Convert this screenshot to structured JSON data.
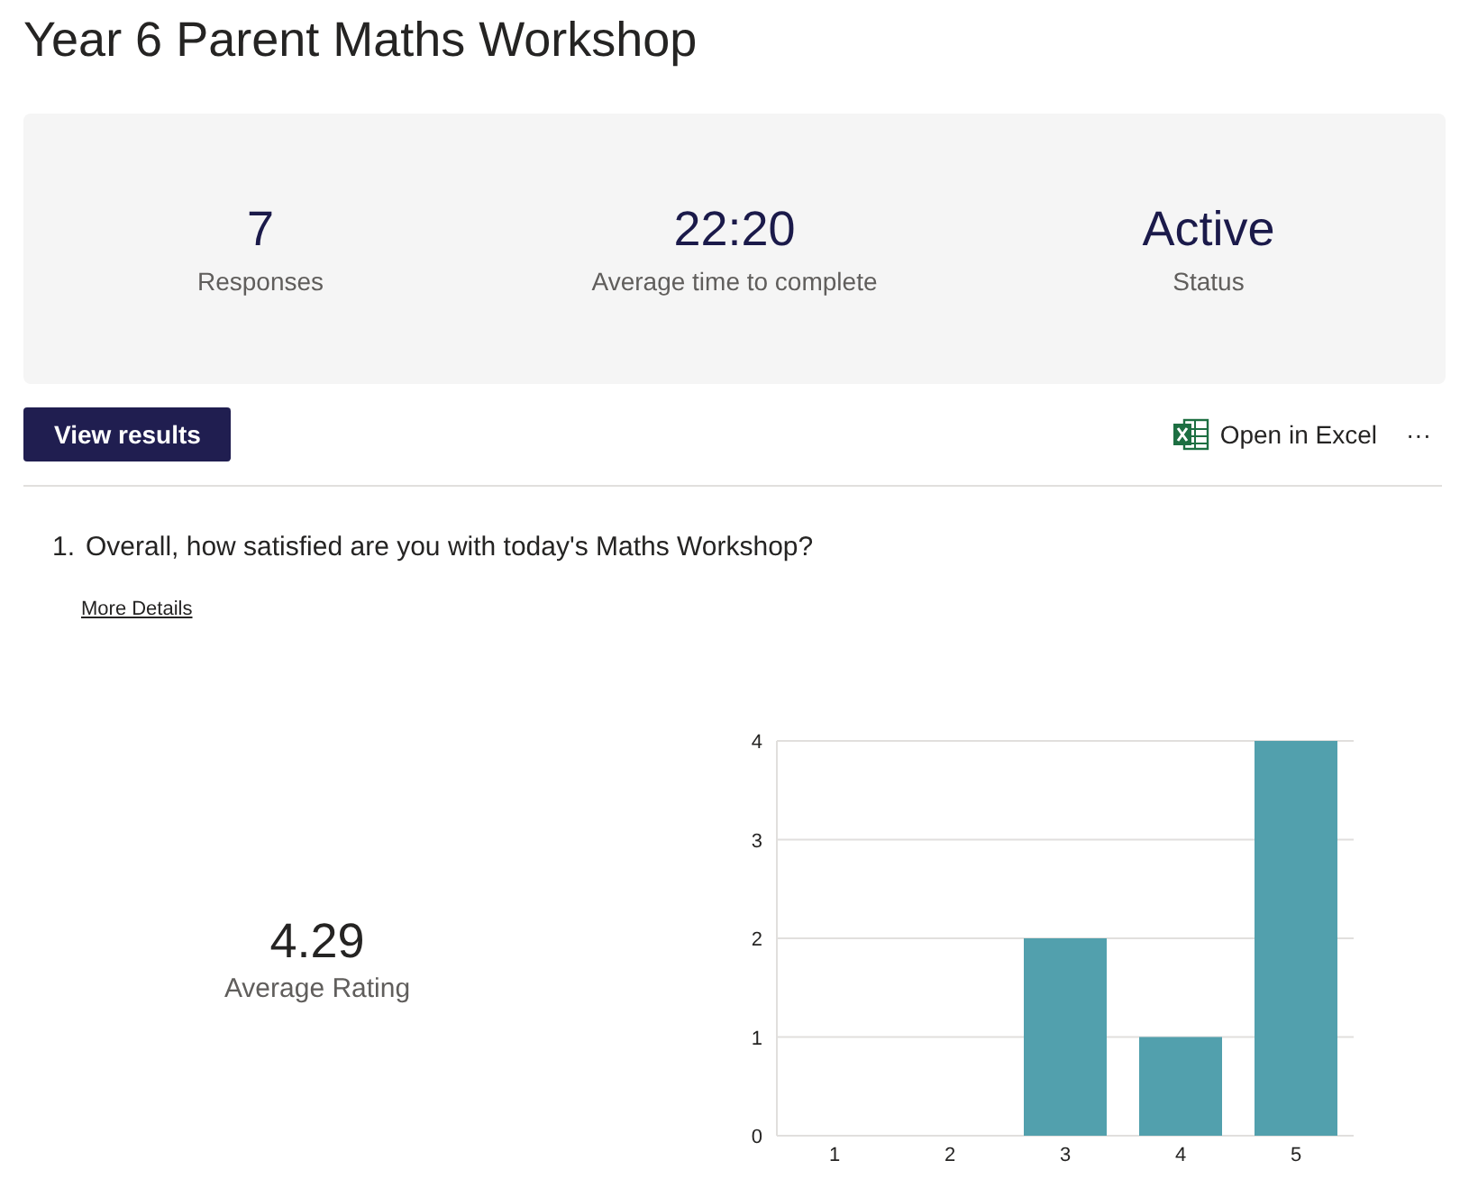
{
  "title": "Year 6 Parent Maths Workshop",
  "stats": [
    {
      "value": "7",
      "label": "Responses"
    },
    {
      "value": "22:20",
      "label": "Average time to complete"
    },
    {
      "value": "Active",
      "label": "Status"
    }
  ],
  "view_results_button": "View results",
  "open_in_excel": "Open in Excel",
  "more_button": "···",
  "questions": [
    {
      "number": "1.",
      "text": "Overall, how satisfied are you with today's Maths Workshop?",
      "more_details": "More Details",
      "average_value": "4.29",
      "average_label": "Average Rating",
      "chart_data": {
        "type": "bar",
        "categories": [
          "1",
          "2",
          "3",
          "4",
          "5"
        ],
        "series": [
          {
            "color": "#52a0ad",
            "values": [
              0,
              0,
              2,
              1,
              4
            ]
          }
        ],
        "ylim": [
          0,
          4
        ],
        "yticks": [
          0,
          1,
          2,
          3,
          4
        ],
        "grid": true
      }
    }
  ]
}
